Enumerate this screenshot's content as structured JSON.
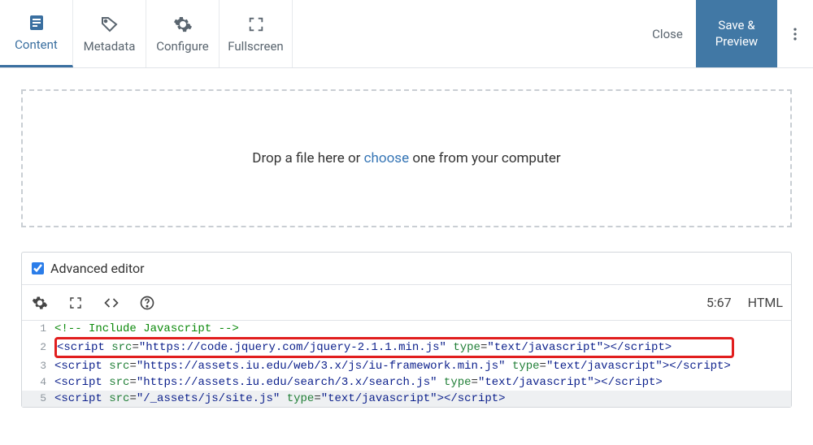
{
  "toolbar": {
    "tabs": [
      {
        "key": "content",
        "label": "Content",
        "icon": "content-icon",
        "active": true
      },
      {
        "key": "metadata",
        "label": "Metadata",
        "icon": "tag-icon",
        "active": false
      },
      {
        "key": "configure",
        "label": "Configure",
        "icon": "gear-icon",
        "active": false
      },
      {
        "key": "fullscreen",
        "label": "Fullscreen",
        "icon": "fullscreen-icon",
        "active": false
      }
    ],
    "close_label": "Close",
    "save_label": "Save & Preview"
  },
  "dropzone": {
    "text_before": "Drop a file here or ",
    "link": "choose",
    "text_after": " one from your computer"
  },
  "editor": {
    "advanced_label": "Advanced editor",
    "advanced_checked": true,
    "cursor_pos": "5:67",
    "mode_label": "HTML",
    "lines": {
      "l1_num": "1",
      "l1_content": "<!-- Include Javascript -->",
      "l2_num": "2",
      "l2_src": "https://code.jquery.com/jquery-2.1.1.min.js",
      "l2_type": "text/javascript",
      "l3_num": "3",
      "l3_src": "https://assets.iu.edu/web/3.x/js/iu-framework.min.js",
      "l3_type": "text/javascript",
      "l4_num": "4",
      "l4_src": "https://assets.iu.edu/search/3.x/search.js",
      "l4_type": "text/javascript",
      "l5_num": "5",
      "l5_src": "/_assets/js/site.js",
      "l5_type": "text/javascript"
    }
  },
  "colors": {
    "accent": "#3a6fa0",
    "save_bg": "#4178a5",
    "highlight_border": "#e11e1e"
  }
}
